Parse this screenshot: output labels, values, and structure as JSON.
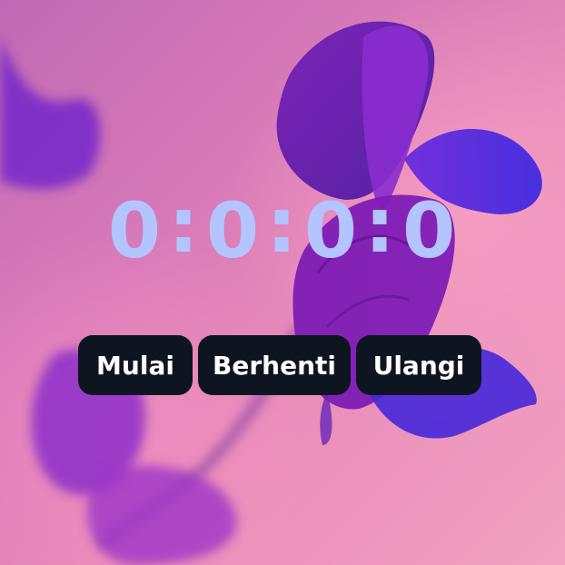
{
  "timer": {
    "hours": "0",
    "minutes": "0",
    "seconds": "0",
    "centiseconds": "0",
    "separator": ":"
  },
  "buttons": {
    "start": "Mulai",
    "stop": "Berhenti",
    "reset": "Ulangi"
  },
  "colors": {
    "timer_text": "#b3c4ff",
    "button_bg": "#0e1520",
    "button_text": "#ffffff"
  }
}
